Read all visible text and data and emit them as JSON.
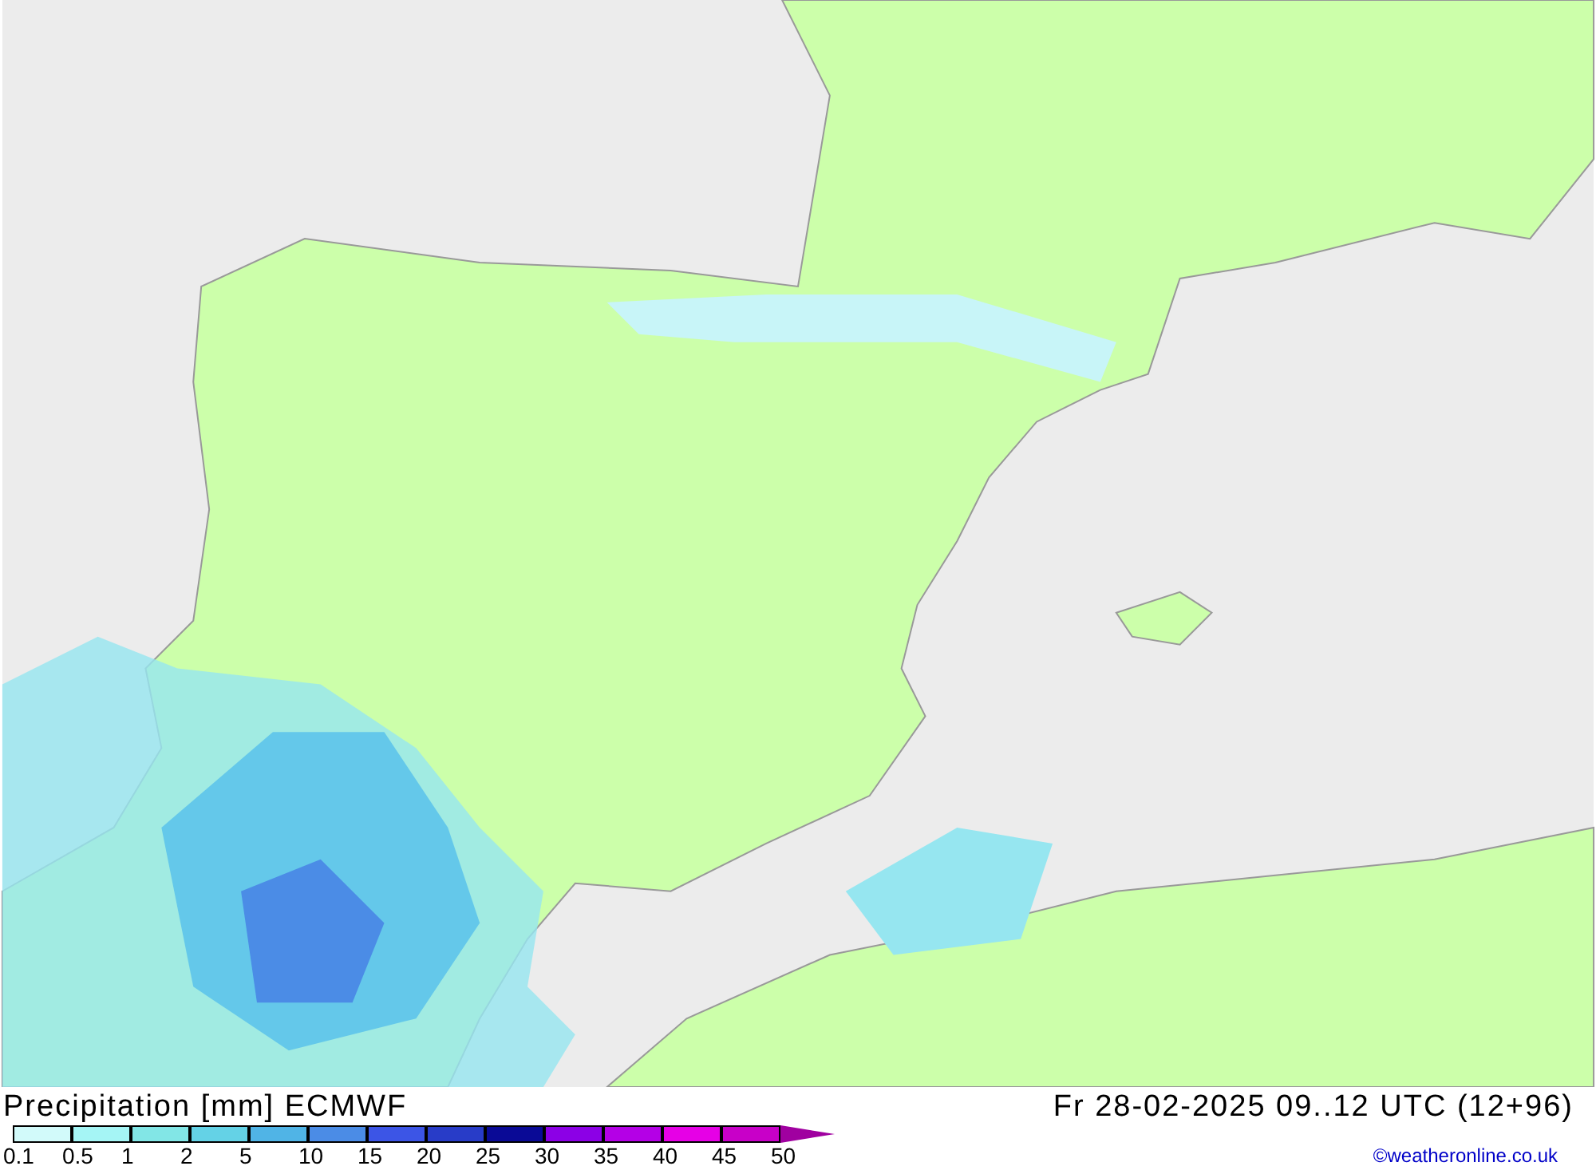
{
  "title": "Precipitation [mm] ECMWF",
  "valid_time": "Fr 28-02-2025 09..12 UTC (12+96)",
  "legend": [
    {
      "label": "0.1",
      "color": "#d2fafa"
    },
    {
      "label": "0.5",
      "color": "#a5f5f5"
    },
    {
      "label": "1",
      "color": "#82e6e6"
    },
    {
      "label": "2",
      "color": "#64d2e6"
    },
    {
      "label": "5",
      "color": "#50b4e6"
    },
    {
      "label": "10",
      "color": "#4b8ce6"
    },
    {
      "label": "15",
      "color": "#3c55e6"
    },
    {
      "label": "20",
      "color": "#283cc8"
    },
    {
      "label": "25",
      "color": "#0a0a96"
    },
    {
      "label": "30",
      "color": "#8c00e6"
    },
    {
      "label": "35",
      "color": "#b400e6"
    },
    {
      "label": "40",
      "color": "#e600e6"
    },
    {
      "label": "45",
      "color": "#c800c8"
    },
    {
      "label": "50",
      "color": "#a000a0"
    }
  ],
  "credit": "©weatheronline.co.uk"
}
